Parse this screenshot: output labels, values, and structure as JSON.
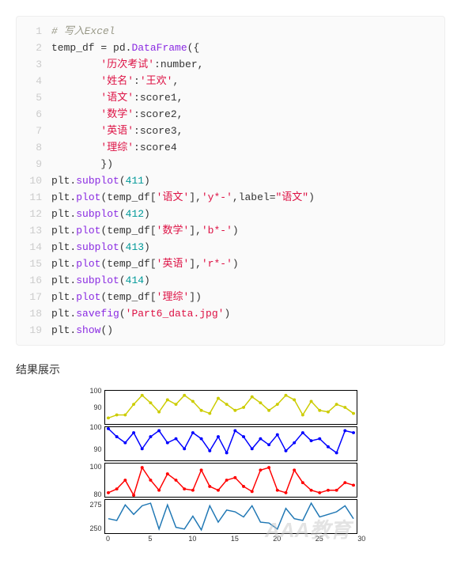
{
  "code": {
    "lines": [
      {
        "n": "1",
        "tokens": [
          {
            "t": "# 写入Excel",
            "c": "hl-comment"
          }
        ]
      },
      {
        "n": "2",
        "tokens": [
          {
            "t": "temp_df ",
            "c": "hl-var"
          },
          {
            "t": "= ",
            "c": "hl-op"
          },
          {
            "t": "pd",
            "c": "hl-key"
          },
          {
            "t": ".",
            "c": "hl-op"
          },
          {
            "t": "DataFrame",
            "c": "hl-func"
          },
          {
            "t": "({",
            "c": "hl-paren"
          }
        ]
      },
      {
        "n": "3",
        "tokens": [
          {
            "t": "        ",
            "c": ""
          },
          {
            "t": "'历次考试'",
            "c": "hl-str"
          },
          {
            "t": ":number,",
            "c": "hl-op"
          }
        ]
      },
      {
        "n": "4",
        "tokens": [
          {
            "t": "        ",
            "c": ""
          },
          {
            "t": "'姓名'",
            "c": "hl-str"
          },
          {
            "t": ":",
            "c": "hl-op"
          },
          {
            "t": "'王欢'",
            "c": "hl-str"
          },
          {
            "t": ",",
            "c": "hl-op"
          }
        ]
      },
      {
        "n": "5",
        "tokens": [
          {
            "t": "        ",
            "c": ""
          },
          {
            "t": "'语文'",
            "c": "hl-str"
          },
          {
            "t": ":score1,",
            "c": "hl-op"
          }
        ]
      },
      {
        "n": "6",
        "tokens": [
          {
            "t": "        ",
            "c": ""
          },
          {
            "t": "'数学'",
            "c": "hl-str"
          },
          {
            "t": ":score2,",
            "c": "hl-op"
          }
        ]
      },
      {
        "n": "7",
        "tokens": [
          {
            "t": "        ",
            "c": ""
          },
          {
            "t": "'英语'",
            "c": "hl-str"
          },
          {
            "t": ":score3,",
            "c": "hl-op"
          }
        ]
      },
      {
        "n": "8",
        "tokens": [
          {
            "t": "        ",
            "c": ""
          },
          {
            "t": "'理综'",
            "c": "hl-str"
          },
          {
            "t": ":score4",
            "c": "hl-op"
          }
        ]
      },
      {
        "n": "9",
        "tokens": [
          {
            "t": "        })",
            "c": "hl-paren"
          }
        ]
      },
      {
        "n": "10",
        "tokens": [
          {
            "t": "plt.",
            "c": "hl-key"
          },
          {
            "t": "subplot",
            "c": "hl-func"
          },
          {
            "t": "(",
            "c": "hl-paren"
          },
          {
            "t": "411",
            "c": "hl-num"
          },
          {
            "t": ")",
            "c": "hl-paren"
          }
        ]
      },
      {
        "n": "11",
        "tokens": [
          {
            "t": "plt.",
            "c": "hl-key"
          },
          {
            "t": "plot",
            "c": "hl-func"
          },
          {
            "t": "(temp_df[",
            "c": "hl-paren"
          },
          {
            "t": "'语文'",
            "c": "hl-str"
          },
          {
            "t": "],",
            "c": "hl-paren"
          },
          {
            "t": "'y*-'",
            "c": "hl-str"
          },
          {
            "t": ",label=",
            "c": "hl-paren"
          },
          {
            "t": "\"语文\"",
            "c": "hl-str"
          },
          {
            "t": ")",
            "c": "hl-paren"
          }
        ]
      },
      {
        "n": "12",
        "tokens": [
          {
            "t": "plt.",
            "c": "hl-key"
          },
          {
            "t": "subplot",
            "c": "hl-func"
          },
          {
            "t": "(",
            "c": "hl-paren"
          },
          {
            "t": "412",
            "c": "hl-num"
          },
          {
            "t": ")",
            "c": "hl-paren"
          }
        ]
      },
      {
        "n": "13",
        "tokens": [
          {
            "t": "plt.",
            "c": "hl-key"
          },
          {
            "t": "plot",
            "c": "hl-func"
          },
          {
            "t": "(temp_df[",
            "c": "hl-paren"
          },
          {
            "t": "'数学'",
            "c": "hl-str"
          },
          {
            "t": "],",
            "c": "hl-paren"
          },
          {
            "t": "'b*-'",
            "c": "hl-str"
          },
          {
            "t": ")",
            "c": "hl-paren"
          }
        ]
      },
      {
        "n": "14",
        "tokens": [
          {
            "t": "plt.",
            "c": "hl-key"
          },
          {
            "t": "subplot",
            "c": "hl-func"
          },
          {
            "t": "(",
            "c": "hl-paren"
          },
          {
            "t": "413",
            "c": "hl-num"
          },
          {
            "t": ")",
            "c": "hl-paren"
          }
        ]
      },
      {
        "n": "15",
        "tokens": [
          {
            "t": "plt.",
            "c": "hl-key"
          },
          {
            "t": "plot",
            "c": "hl-func"
          },
          {
            "t": "(temp_df[",
            "c": "hl-paren"
          },
          {
            "t": "'英语'",
            "c": "hl-str"
          },
          {
            "t": "],",
            "c": "hl-paren"
          },
          {
            "t": "'r*-'",
            "c": "hl-str"
          },
          {
            "t": ")",
            "c": "hl-paren"
          }
        ]
      },
      {
        "n": "16",
        "tokens": [
          {
            "t": "plt.",
            "c": "hl-key"
          },
          {
            "t": "subplot",
            "c": "hl-func"
          },
          {
            "t": "(",
            "c": "hl-paren"
          },
          {
            "t": "414",
            "c": "hl-num"
          },
          {
            "t": ")",
            "c": "hl-paren"
          }
        ]
      },
      {
        "n": "17",
        "tokens": [
          {
            "t": "plt.",
            "c": "hl-key"
          },
          {
            "t": "plot",
            "c": "hl-func"
          },
          {
            "t": "(temp_df[",
            "c": "hl-paren"
          },
          {
            "t": "'理综'",
            "c": "hl-str"
          },
          {
            "t": "])",
            "c": "hl-paren"
          }
        ]
      },
      {
        "n": "18",
        "tokens": [
          {
            "t": "plt.",
            "c": "hl-key"
          },
          {
            "t": "savefig",
            "c": "hl-func"
          },
          {
            "t": "(",
            "c": "hl-paren"
          },
          {
            "t": "'Part6_data.jpg'",
            "c": "hl-str"
          },
          {
            "t": ")",
            "c": "hl-paren"
          }
        ]
      },
      {
        "n": "19",
        "tokens": [
          {
            "t": "plt.",
            "c": "hl-key"
          },
          {
            "t": "show",
            "c": "hl-func"
          },
          {
            "t": "()",
            "c": "hl-paren"
          }
        ]
      }
    ]
  },
  "result_label": "结果展示",
  "watermark": "AAA教育",
  "chart_data": [
    {
      "type": "line",
      "name": "语文",
      "color": "#cccc00",
      "marker": "*",
      "ylim": [
        80,
        100
      ],
      "yticks": [
        90,
        100
      ],
      "x": [
        0,
        1,
        2,
        3,
        4,
        5,
        6,
        7,
        8,
        9,
        10,
        11,
        12,
        13,
        14,
        15,
        16,
        17,
        18,
        19,
        20,
        21,
        22,
        23,
        24,
        25,
        26,
        27,
        28,
        29
      ],
      "values": [
        83,
        85,
        85,
        92,
        98,
        93,
        87,
        95,
        92,
        98,
        94,
        88,
        86,
        96,
        92,
        88,
        90,
        97,
        93,
        88,
        92,
        98,
        95,
        85,
        94,
        88,
        87,
        92,
        90,
        86
      ]
    },
    {
      "type": "line",
      "name": "数学",
      "color": "#0000ff",
      "marker": "*",
      "ylim": [
        85,
        100
      ],
      "yticks": [
        90,
        100
      ],
      "x": [
        0,
        1,
        2,
        3,
        4,
        5,
        6,
        7,
        8,
        9,
        10,
        11,
        12,
        13,
        14,
        15,
        16,
        17,
        18,
        19,
        20,
        21,
        22,
        23,
        24,
        25,
        26,
        27,
        28,
        29
      ],
      "values": [
        100,
        96,
        93,
        98,
        90,
        96,
        99,
        93,
        95,
        90,
        98,
        95,
        89,
        96,
        88,
        99,
        96,
        90,
        95,
        92,
        97,
        89,
        93,
        98,
        94,
        95,
        91,
        88,
        99,
        98
      ]
    },
    {
      "type": "line",
      "name": "英语",
      "color": "#ff0000",
      "marker": "*",
      "ylim": [
        78,
        102
      ],
      "yticks": [
        80,
        100
      ],
      "x": [
        0,
        1,
        2,
        3,
        4,
        5,
        6,
        7,
        8,
        9,
        10,
        11,
        12,
        13,
        14,
        15,
        16,
        17,
        18,
        19,
        20,
        21,
        22,
        23,
        24,
        25,
        26,
        27,
        28,
        29
      ],
      "values": [
        80,
        83,
        90,
        78,
        100,
        90,
        82,
        95,
        90,
        83,
        82,
        98,
        85,
        82,
        90,
        92,
        85,
        81,
        98,
        100,
        82,
        80,
        98,
        88,
        82,
        80,
        82,
        82,
        88,
        86
      ]
    },
    {
      "type": "line",
      "name": "理综",
      "color": "#1f77b4",
      "marker": "",
      "ylim": [
        245,
        280
      ],
      "yticks": [
        250,
        275
      ],
      "xticks": [
        0,
        5,
        10,
        15,
        20,
        25,
        30
      ],
      "x": [
        0,
        1,
        2,
        3,
        4,
        5,
        6,
        7,
        8,
        9,
        10,
        11,
        12,
        13,
        14,
        15,
        16,
        17,
        18,
        19,
        20,
        21,
        22,
        23,
        24,
        25,
        26,
        27,
        28,
        29
      ],
      "values": [
        260,
        258,
        276,
        265,
        275,
        278,
        248,
        276,
        250,
        248,
        263,
        247,
        275,
        256,
        270,
        268,
        262,
        275,
        256,
        255,
        248,
        272,
        260,
        258,
        278,
        262,
        265,
        268,
        275,
        260
      ]
    }
  ]
}
